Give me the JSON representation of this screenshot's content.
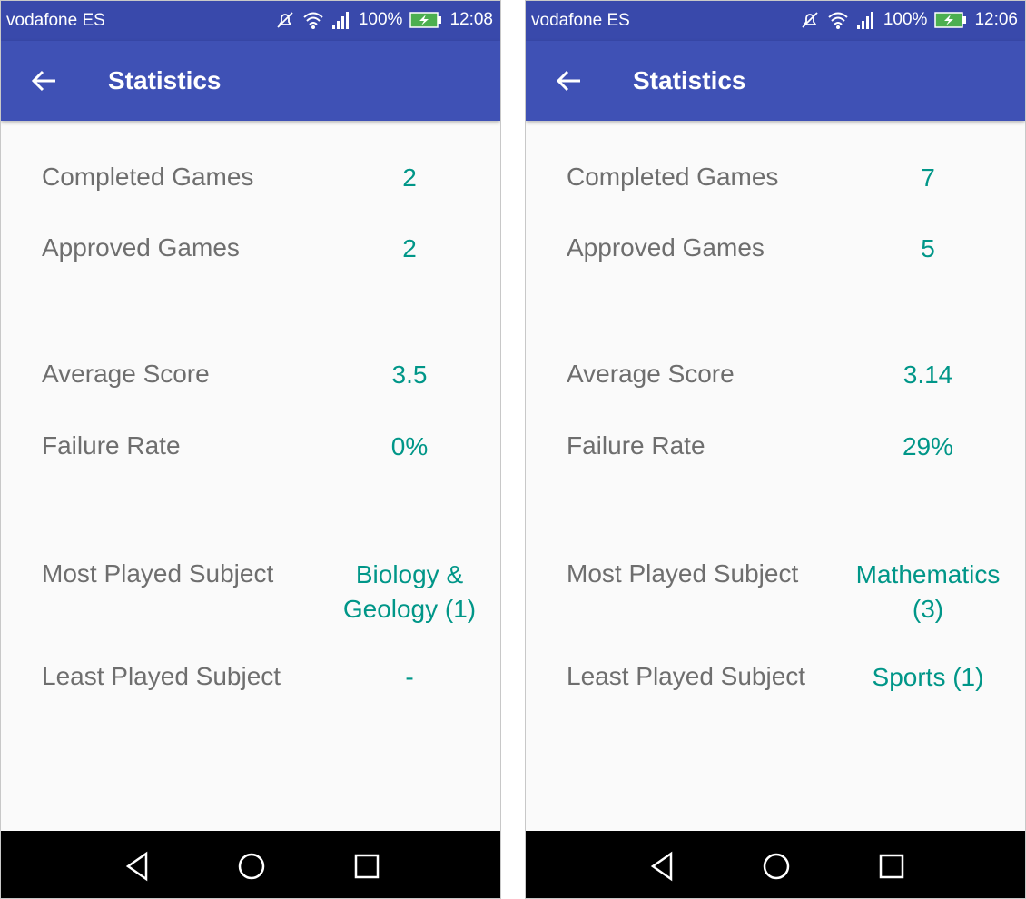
{
  "screens": [
    {
      "status": {
        "carrier": "vodafone ES",
        "battery": "100%",
        "time": "12:08"
      },
      "title": "Statistics",
      "stats": {
        "completed": {
          "label": "Completed Games",
          "value": "2"
        },
        "approved": {
          "label": "Approved Games",
          "value": "2"
        },
        "average": {
          "label": "Average Score",
          "value": "3.5"
        },
        "failure": {
          "label": "Failure Rate",
          "value": "0%"
        },
        "most": {
          "label": "Most Played Subject",
          "value_line1": "Biology &",
          "value_line2": "Geology (1)"
        },
        "least": {
          "label": "Least Played Subject",
          "value": "-"
        }
      }
    },
    {
      "status": {
        "carrier": "vodafone ES",
        "battery": "100%",
        "time": "12:06"
      },
      "title": "Statistics",
      "stats": {
        "completed": {
          "label": "Completed Games",
          "value": "7"
        },
        "approved": {
          "label": "Approved Games",
          "value": "5"
        },
        "average": {
          "label": "Average Score",
          "value": "3.14"
        },
        "failure": {
          "label": "Failure Rate",
          "value": "29%"
        },
        "most": {
          "label": "Most Played Subject",
          "value_line1": "Mathematics",
          "value_line2": "(3)"
        },
        "least": {
          "label": "Least Played Subject",
          "value": "Sports (1)"
        }
      }
    }
  ],
  "colors": {
    "status_bar": "#3949ab",
    "app_bar": "#3f51b5",
    "accent_value": "#009688",
    "label_text": "#6e6e6e",
    "nav_bar": "#000000"
  },
  "icons": {
    "status": [
      "mute-icon",
      "wifi-icon",
      "signal-icon",
      "battery-charging-icon"
    ],
    "app_bar": [
      "back-arrow-icon"
    ],
    "navigation": [
      "nav-back-icon",
      "nav-home-icon",
      "nav-recents-icon"
    ]
  }
}
